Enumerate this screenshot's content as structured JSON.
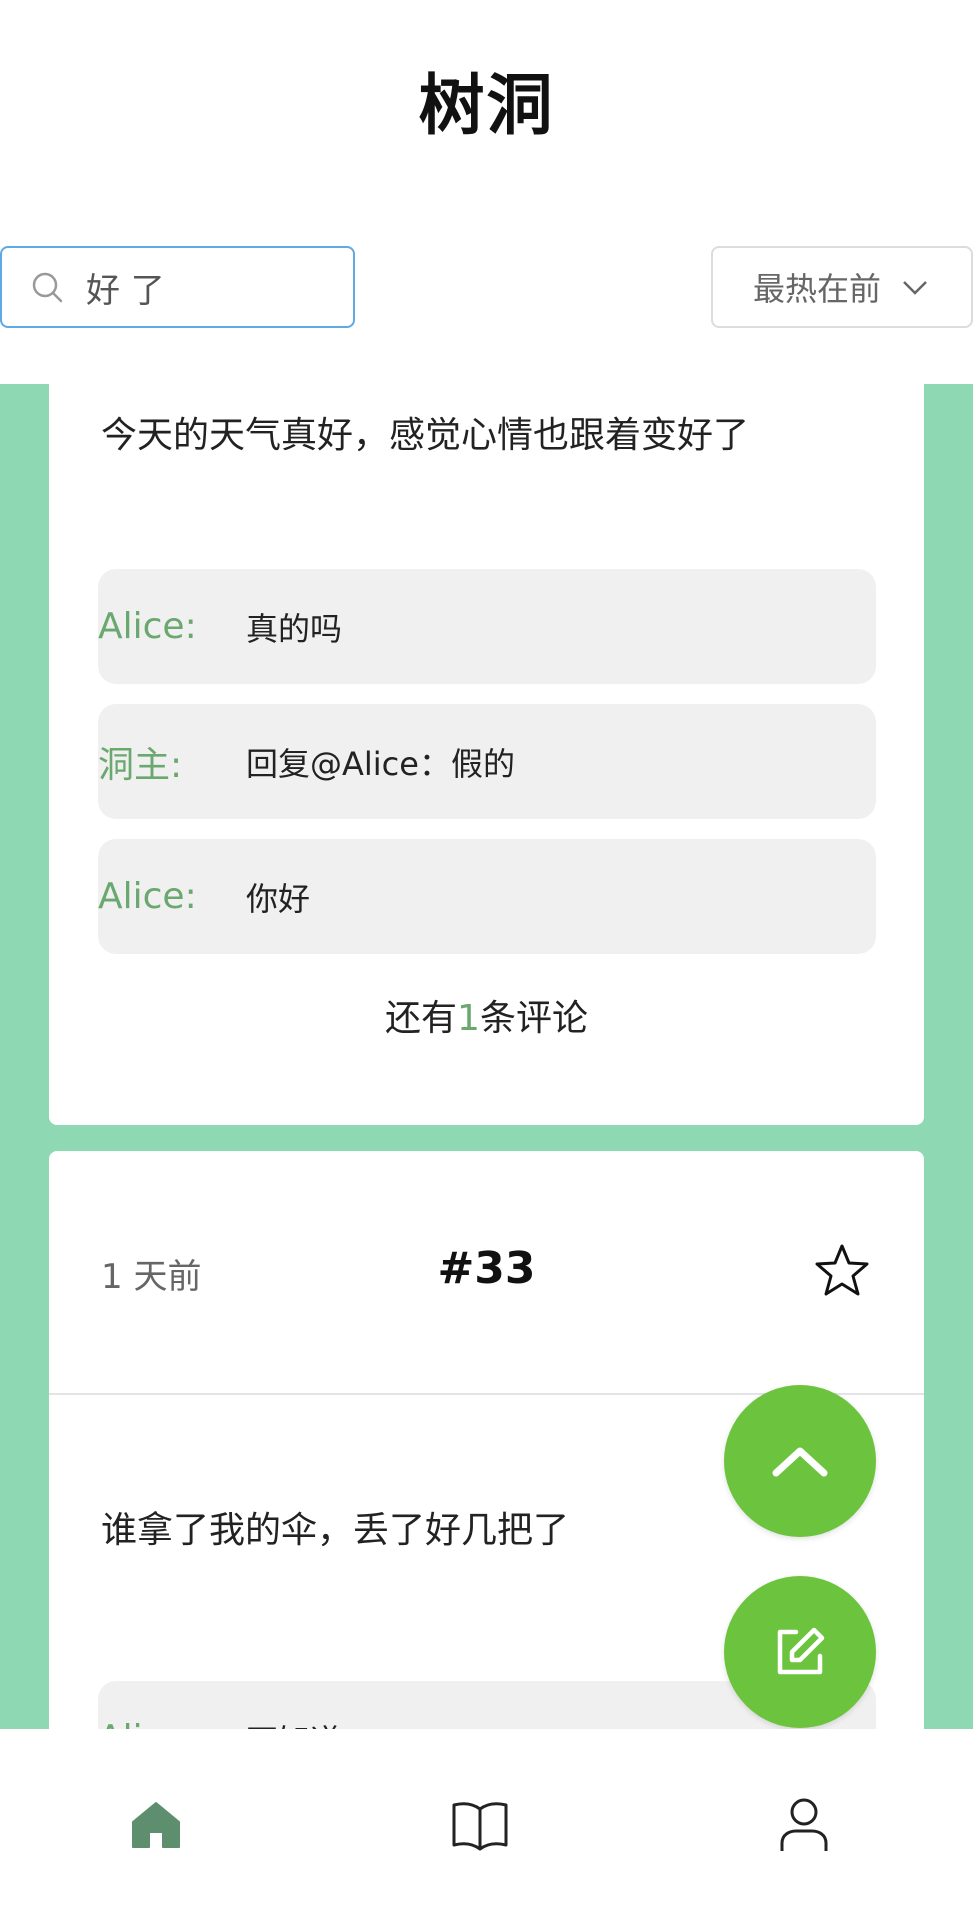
{
  "header": {
    "title": "树洞"
  },
  "search": {
    "value": "好 了",
    "placeholder": ""
  },
  "sort": {
    "selected": "最热在前"
  },
  "posts": [
    {
      "text": "今天的天气真好，感觉心情也跟着变好了",
      "comments": [
        {
          "author": "Alice:",
          "text": "真的吗"
        },
        {
          "author": "洞主:",
          "text": "回复@Alice：假的"
        },
        {
          "author": "Alice:",
          "text": "你好"
        }
      ],
      "more_prefix": "还有",
      "more_count": "1",
      "more_suffix": "条评论"
    },
    {
      "time": "1 天前",
      "id": "#33",
      "text": "谁拿了我的伞，丢了好几把了",
      "comments": [
        {
          "author": "Ali",
          "text": "不知道"
        }
      ]
    }
  ],
  "fabs": {
    "up": "chevron-up-icon",
    "edit": "edit-icon"
  },
  "tabs": [
    "home-icon",
    "book-icon",
    "user-icon"
  ],
  "colors": {
    "accent": "#6cc33d",
    "feed_bg": "#8ed8b3",
    "comment_author": "#6aa86f",
    "home_active": "#5d8f6f"
  }
}
